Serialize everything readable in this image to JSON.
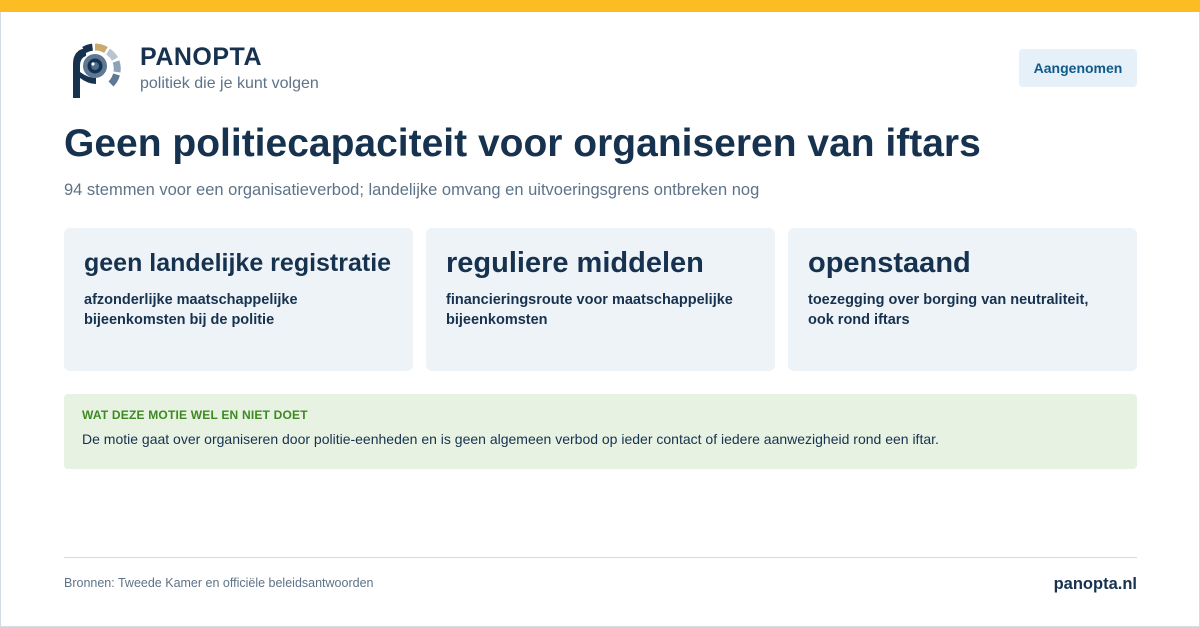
{
  "brand": {
    "name": "PANOPTA",
    "tagline": "politiek die je kunt volgen",
    "logo": "panopta-eye-p-logo",
    "accent": "#fbbd23"
  },
  "status": "Aangenomen",
  "headline": "Geen politiecapaciteit voor organiseren van iftars",
  "subtitle": "94 stemmen voor een organisatieverbod; landelijke omvang en uitvoeringsgrens ontbreken nog",
  "cards": [
    {
      "title": "geen landelijke registratie",
      "body": "afzonderlijke maatschappelijke bijeenkomsten bij de politie"
    },
    {
      "title": "reguliere middelen",
      "body": "financieringsroute voor maatschappelijke bijeenkomsten"
    },
    {
      "title": "openstaand",
      "body": "toezegging over borging van neutraliteit, ook rond iftars"
    }
  ],
  "note": {
    "label": "WAT DEZE MOTIE WEL EN NIET DOET",
    "text": "De motie gaat over organiseren door politie-eenheden en is geen algemeen verbod op ieder contact of iedere aanwezigheid rond een iftar."
  },
  "footer": {
    "sources": "Bronnen: Tweede Kamer en officiële beleidsantwoorden",
    "site": "panopta.nl"
  }
}
